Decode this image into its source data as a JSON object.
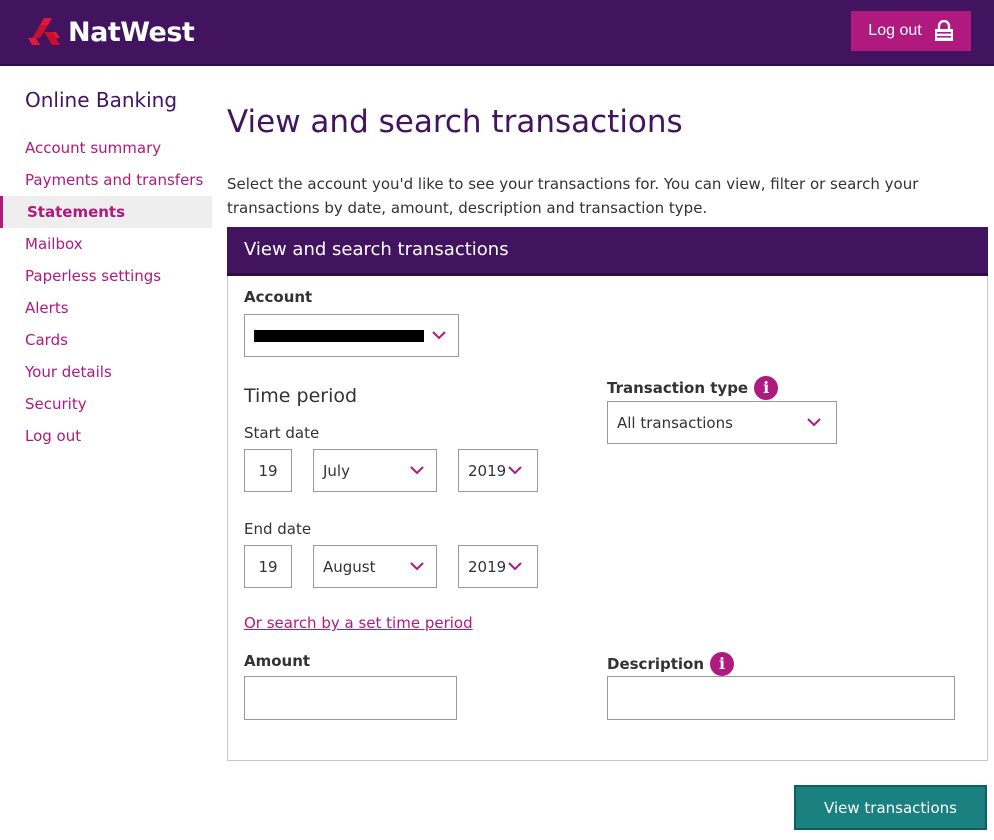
{
  "header": {
    "brand": "NatWest",
    "logout_label": "Log out"
  },
  "sidebar": {
    "title": "Online Banking",
    "items": [
      {
        "label": "Account summary"
      },
      {
        "label": "Payments and transfers"
      },
      {
        "label": "Statements",
        "active": true
      },
      {
        "label": "Mailbox"
      },
      {
        "label": "Paperless settings"
      },
      {
        "label": "Alerts"
      },
      {
        "label": "Cards"
      },
      {
        "label": "Your details"
      },
      {
        "label": "Security"
      },
      {
        "label": "Log out"
      }
    ]
  },
  "main": {
    "title": "View and search transactions",
    "intro": "Select the account you'd like to see your transactions for. You can view, filter or search your transactions by date, amount, description and transaction type."
  },
  "form": {
    "heading": "View and search transactions",
    "account_label": "Account",
    "time_period_title": "Time period",
    "start_date_label": "Start date",
    "start_day": "19",
    "start_month": "July",
    "start_year": "2019",
    "end_date_label": "End date",
    "end_day": "19",
    "end_month": "August",
    "end_year": "2019",
    "set_period_link": "Or search by a set time period",
    "transaction_type_label": "Transaction type",
    "transaction_type_value": "All transactions",
    "amount_label": "Amount",
    "description_label": "Description",
    "amount_value": "",
    "description_value": "",
    "submit_label": "View transactions"
  },
  "colors": {
    "brand_purple": "#42145f",
    "accent_magenta": "#b0197e",
    "button_teal": "#1a8080"
  }
}
